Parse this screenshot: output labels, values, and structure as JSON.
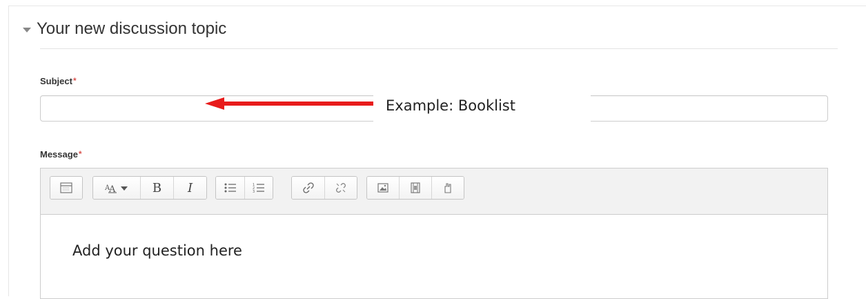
{
  "section": {
    "title": "Your new discussion topic"
  },
  "subject": {
    "label": "Subject",
    "required_marker": "*",
    "value": "",
    "placeholder": ""
  },
  "annotation": {
    "text": "Example: Booklist",
    "arrow_color": "#e81b1b"
  },
  "message": {
    "label": "Message",
    "required_marker": "*",
    "toolbar": {
      "groups": [
        [
          "toolbar-toggle-icon"
        ],
        [
          "font-style-dropdown-icon",
          "bold-icon",
          "italic-icon"
        ],
        [
          "unordered-list-icon",
          "ordered-list-icon"
        ],
        [
          "link-icon",
          "unlink-icon"
        ],
        [
          "insert-image-icon",
          "insert-media-icon",
          "manage-files-icon"
        ]
      ],
      "bold_glyph": "B",
      "italic_glyph": "I"
    },
    "content": "Add your question here"
  },
  "colors": {
    "required": "#d9534f",
    "border": "#cccccc",
    "toolbar_bg": "#f2f2f2"
  }
}
